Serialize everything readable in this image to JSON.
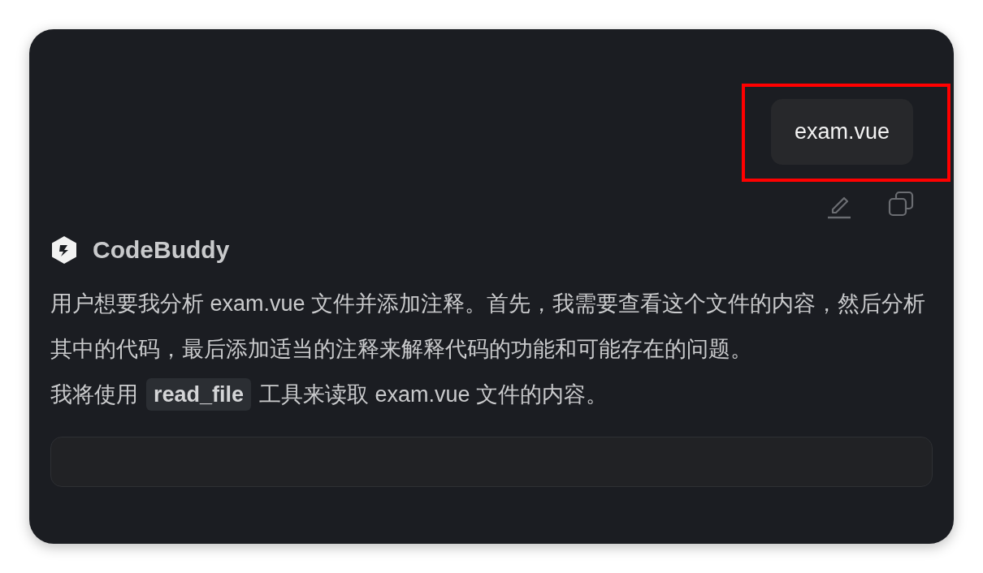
{
  "user_message": {
    "text": "exam.vue",
    "highlighted": true
  },
  "message_actions": [
    {
      "kind": "edit"
    },
    {
      "kind": "copy"
    }
  ],
  "assistant": {
    "name": "CodeBuddy"
  },
  "paragraphs": [
    {
      "parts": [
        {
          "kind": "text",
          "text": "用户想要我分析 exam.vue 文件并添加注释。首先，我需要查看这个文件的内容，然后分析其中的代码，最后添加适当的注释来解释代码的功能和可能存在的问题。"
        }
      ]
    },
    {
      "parts": [
        {
          "kind": "text",
          "text": "我将使用"
        },
        {
          "kind": "code",
          "text": "read_file"
        },
        {
          "kind": "text",
          "text": "工具来读取 exam.vue 文件的内容。"
        }
      ]
    }
  ],
  "tool_block": {
    "kind": "panel"
  }
}
